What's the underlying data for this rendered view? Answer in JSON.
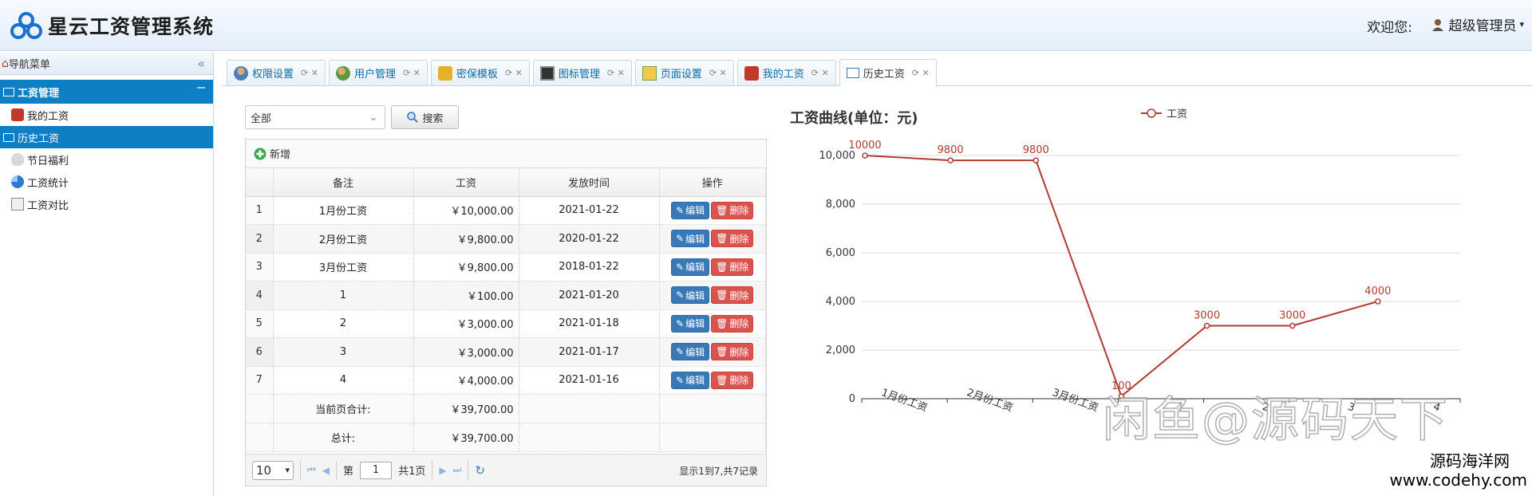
{
  "header": {
    "app_title": "星云工资管理系统",
    "welcome_label": "欢迎您:",
    "user_name": "超级管理员"
  },
  "sidebar": {
    "nav_title": "导航菜单",
    "group_title": "工资管理",
    "items": [
      {
        "label": "我的工资",
        "icon": "my-salary-icon"
      },
      {
        "label": "历史工资",
        "icon": "history-icon",
        "active": true
      },
      {
        "label": "节日福利",
        "icon": "money-bag-icon"
      },
      {
        "label": "工资统计",
        "icon": "pie-chart-icon"
      },
      {
        "label": "工资对比",
        "icon": "report-icon"
      }
    ]
  },
  "tabs": [
    {
      "label": "权限设置",
      "icon": "users-icon"
    },
    {
      "label": "用户管理",
      "icon": "user-group-icon"
    },
    {
      "label": "密保模板",
      "icon": "lock-icon"
    },
    {
      "label": "图标管理",
      "icon": "image-icon"
    },
    {
      "label": "页面设置",
      "icon": "book-icon"
    },
    {
      "label": "我的工资",
      "icon": "my-salary-icon"
    },
    {
      "label": "历史工资",
      "icon": "history-icon",
      "active": true
    }
  ],
  "toolbar": {
    "filter_value": "全部",
    "search_label": "搜索"
  },
  "grid": {
    "add_label": "新增",
    "columns": [
      "备注",
      "工资",
      "发放时间",
      "操作"
    ],
    "rows": [
      {
        "no": "1",
        "note": "1月份工资",
        "salary": "￥10,000.00",
        "date": "2021-01-22"
      },
      {
        "no": "2",
        "note": "2月份工资",
        "salary": "￥9,800.00",
        "date": "2020-01-22"
      },
      {
        "no": "3",
        "note": "3月份工资",
        "salary": "￥9,800.00",
        "date": "2018-01-22"
      },
      {
        "no": "4",
        "note": "1",
        "salary": "￥100.00",
        "date": "2021-01-20"
      },
      {
        "no": "5",
        "note": "2",
        "salary": "￥3,000.00",
        "date": "2021-01-18"
      },
      {
        "no": "6",
        "note": "3",
        "salary": "￥3,000.00",
        "date": "2021-01-17"
      },
      {
        "no": "7",
        "note": "4",
        "salary": "￥4,000.00",
        "date": "2021-01-16"
      }
    ],
    "edit_label": "编辑",
    "delete_label": "删除",
    "page_total_label": "当前页合计:",
    "page_total_value": "￥39,700.00",
    "grand_total_label": "总计:",
    "grand_total_value": "￥39,700.00"
  },
  "pager": {
    "page_size": "10",
    "page_prefix": "第",
    "current_page": "1",
    "page_suffix": "共1页",
    "info": "显示1到7,共7记录"
  },
  "chart_data": {
    "type": "line",
    "title": "工资曲线(单位：元)",
    "categories": [
      "1月份工资",
      "2月份工资",
      "3月份工资",
      "1",
      "2",
      "3",
      "4"
    ],
    "series": [
      {
        "name": "工资",
        "values": [
          10000,
          9800,
          9800,
          100,
          3000,
          3000,
          4000
        ],
        "color": "#b23a32"
      }
    ],
    "data_labels": [
      "10000",
      "9800",
      "9800",
      "100",
      "3000",
      "3000",
      "4000"
    ],
    "ylim": [
      0,
      10000
    ],
    "yticks": [
      "0",
      "2,000",
      "4,000",
      "6,000",
      "8,000",
      "10,000"
    ],
    "grid": true,
    "legend": "top-center"
  },
  "watermark": {
    "main": "闲鱼@源码天下",
    "site_name": "源码海洋网",
    "site_url": "www.codehy.com"
  },
  "colors": {
    "primary": "#0e7fc4",
    "edit": "#3a79b7",
    "delete": "#d9534f",
    "line": "#b23a32"
  }
}
